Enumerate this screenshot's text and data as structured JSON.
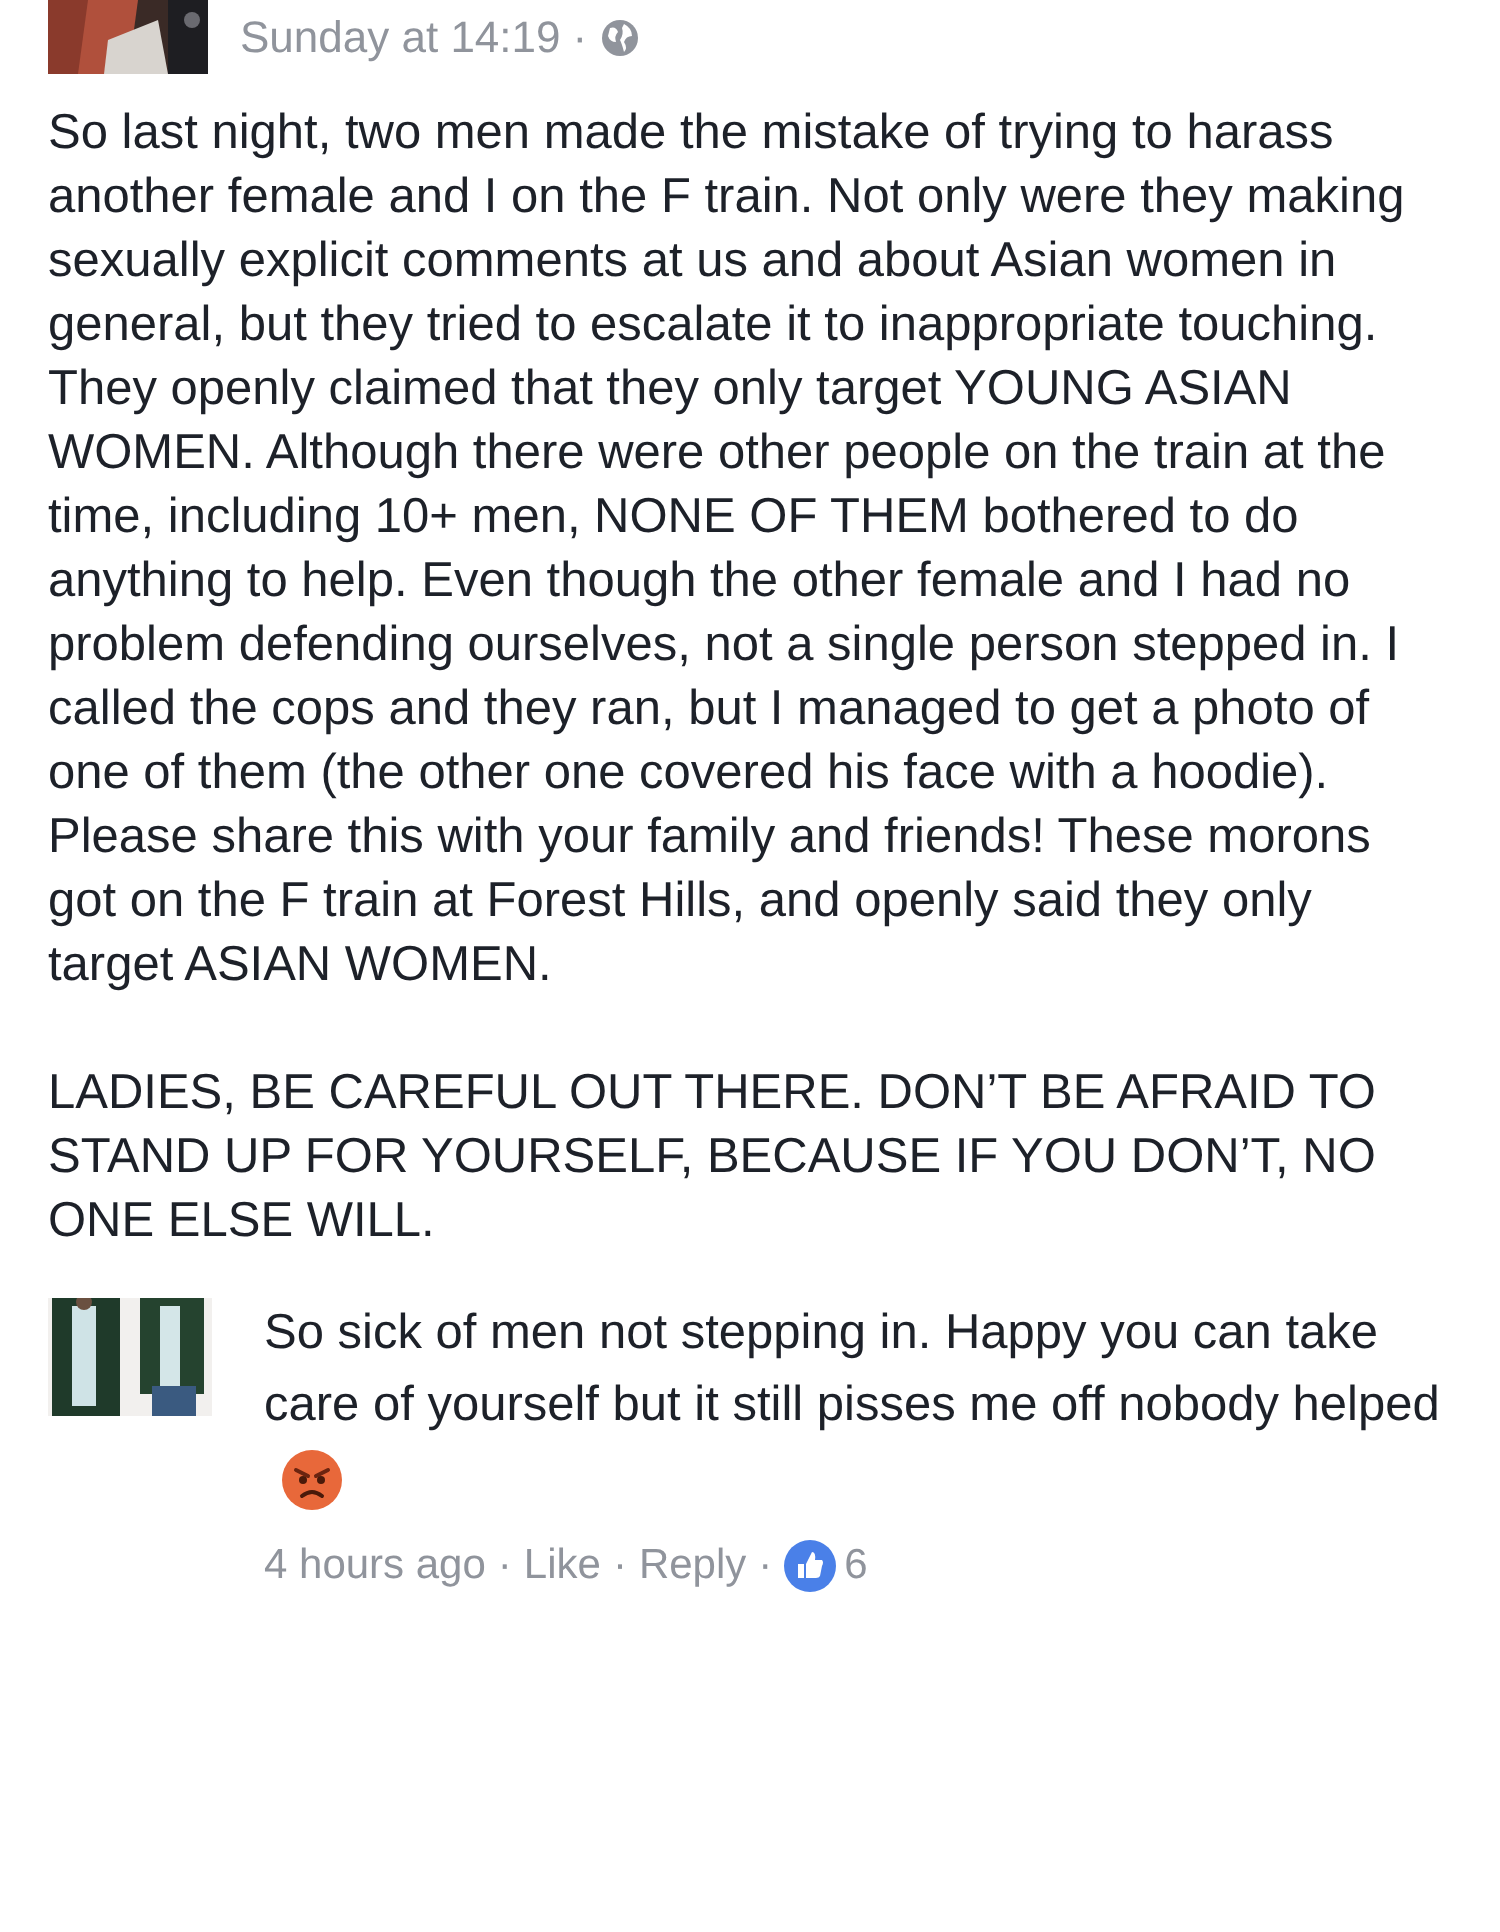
{
  "post": {
    "time": "Sunday at 14:19",
    "separator": "·",
    "paragraphs": [
      "So last night, two men made the mistake of trying to harass another female and I on the F train. Not only were they making sexually explicit comments at us and about Asian women in general, but they tried to escalate it to inappropriate touching. They openly claimed that they only target YOUNG ASIAN WOMEN. Although there were other people on the train at the time, including 10+ men, NONE OF THEM bothered to do anything to help. Even though the other female and I had no problem defending ourselves, not a single person stepped in. I called the cops and they ran, but I managed to get a photo of one of them (the other one covered his face with a hoodie). Please share this with your family and friends! These morons got on the F train at Forest Hills, and openly said they only target ASIAN WOMEN.",
      "LADIES, BE CAREFUL OUT THERE. DON’T BE AFRAID TO STAND UP FOR YOURSELF, BECAUSE IF YOU DON’T, NO ONE ELSE WILL."
    ]
  },
  "comment": {
    "text": "So sick of men not stepping in. Happy you can take care of yourself but it still pisses me off nobody helped",
    "time": "4 hours ago",
    "like": "Like",
    "reply": "Reply",
    "separators": [
      "·",
      "·",
      "·"
    ],
    "like_count": "6"
  }
}
